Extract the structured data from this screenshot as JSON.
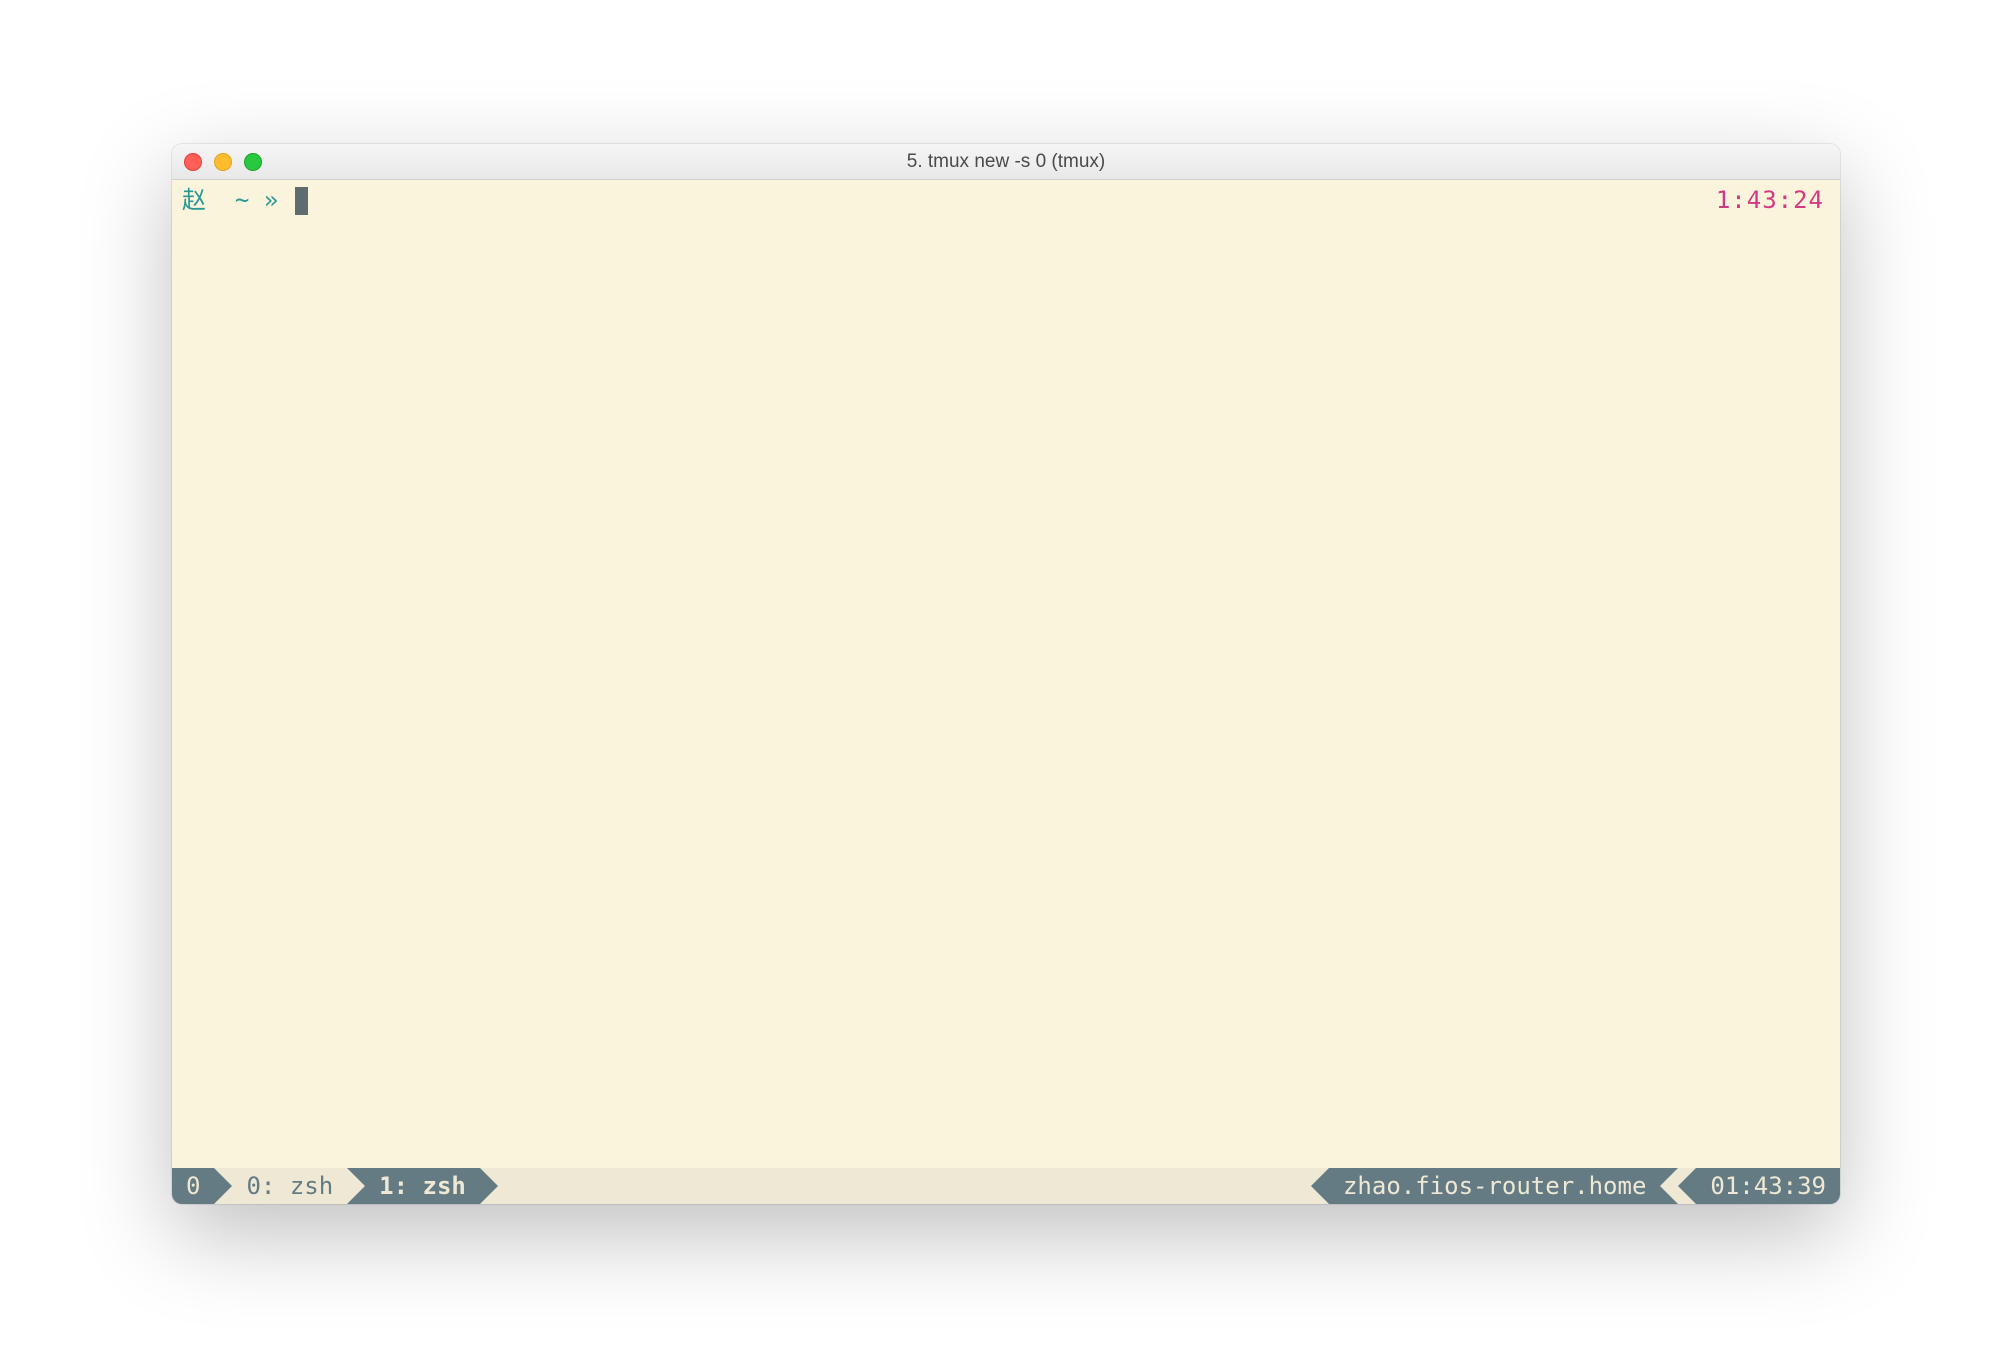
{
  "window": {
    "title": "5. tmux new -s 0 (tmux)"
  },
  "prompt": {
    "user_glyph": "赵",
    "path": "~",
    "arrow": "»",
    "right_time": "1:43:24"
  },
  "status": {
    "session": "0",
    "windows": [
      {
        "index": "0",
        "name": "zsh",
        "active": false
      },
      {
        "index": "1",
        "name": "zsh",
        "active": true
      }
    ],
    "host": "zhao.fios-router.home",
    "clock": "01:43:39"
  }
}
